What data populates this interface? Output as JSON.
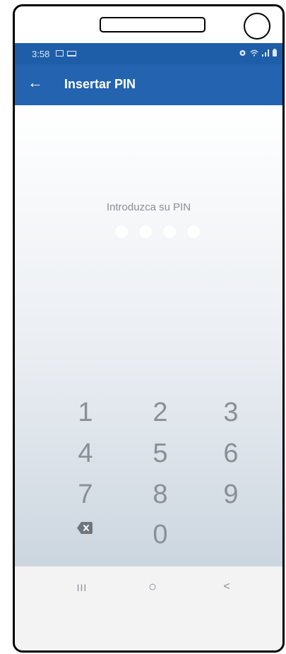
{
  "status_bar": {
    "time": "3:58"
  },
  "header": {
    "title": "Insertar PIN",
    "back_icon": "←"
  },
  "pin": {
    "prompt": "Introduzca su PIN",
    "digits_entered": 0,
    "digits_total": 4
  },
  "keypad": {
    "keys": [
      "1",
      "2",
      "3",
      "4",
      "5",
      "6",
      "7",
      "8",
      "9",
      "0"
    ]
  },
  "nav_bar": {
    "recents": "III",
    "home": "○",
    "back": "<"
  },
  "colors": {
    "status_bar": "#1e5da8",
    "app_bar": "#2363b0",
    "keypad_text": "#8a8f96"
  }
}
